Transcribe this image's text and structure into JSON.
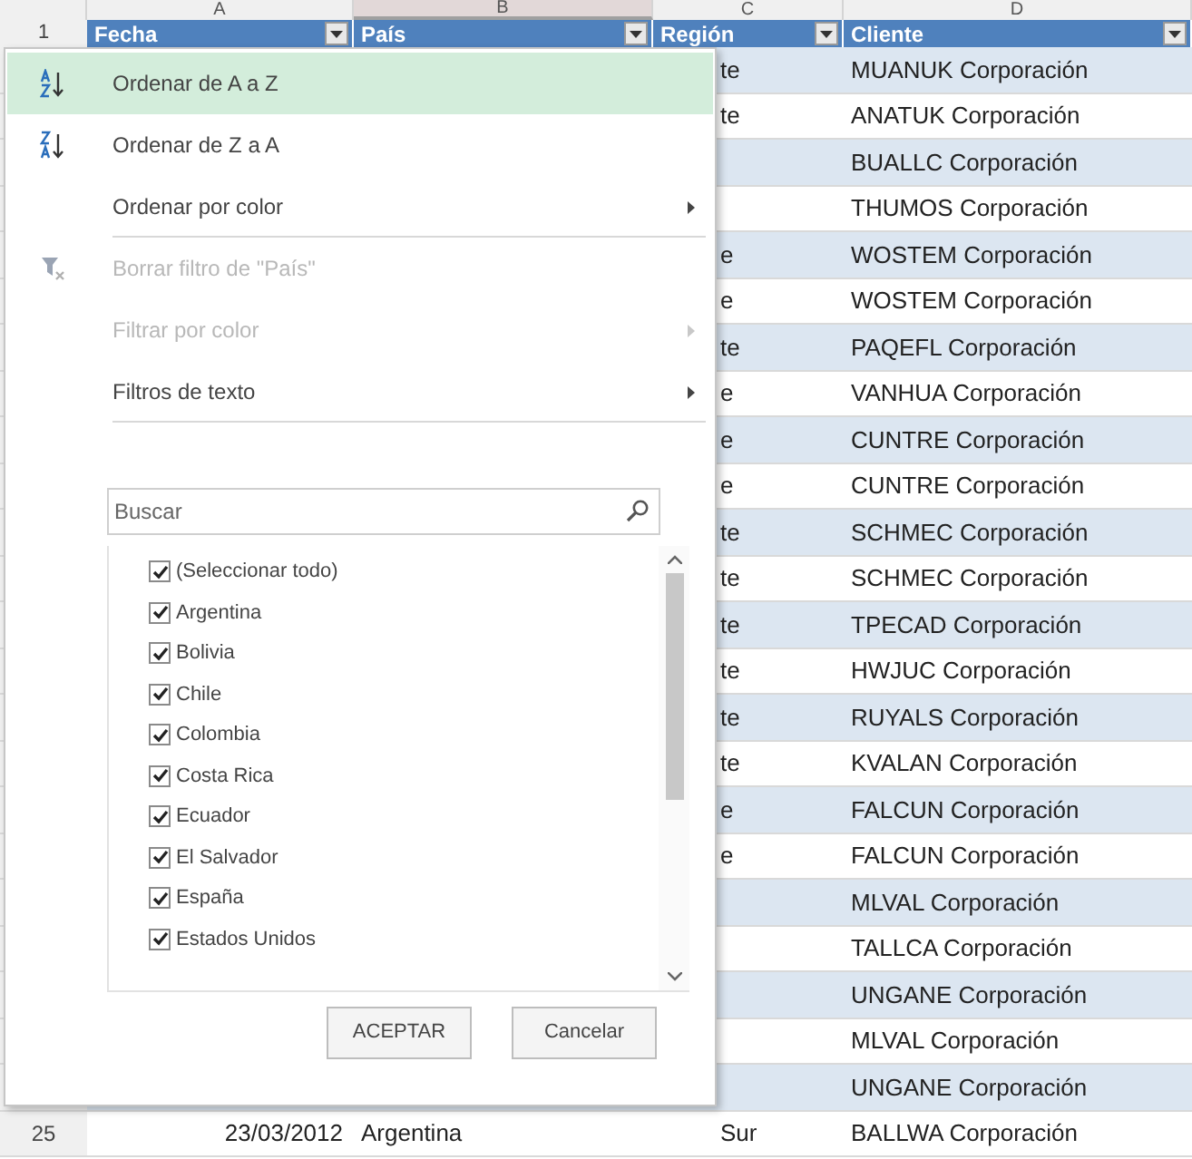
{
  "column_letters": [
    {
      "label": "A",
      "selected": false
    },
    {
      "label": "B",
      "selected": true
    },
    {
      "label": "C",
      "selected": false
    },
    {
      "label": "D",
      "selected": false
    }
  ],
  "header_row": {
    "number": "1",
    "cells": [
      "Fecha",
      "País",
      "Región",
      "Cliente"
    ]
  },
  "rows": [
    {
      "region": "te",
      "client": "MUANUK Corporación"
    },
    {
      "region": "te",
      "client": "ANATUK Corporación"
    },
    {
      "client": "BUALLC Corporación"
    },
    {
      "client": "THUMOS Corporación"
    },
    {
      "region": "e",
      "client": "WOSTEM Corporación"
    },
    {
      "region": "e",
      "client": "WOSTEM Corporación"
    },
    {
      "region": "te",
      "client": "PAQEFL Corporación"
    },
    {
      "region": "e",
      "client": "VANHUA Corporación"
    },
    {
      "region": "e",
      "client": "CUNTRE Corporación"
    },
    {
      "region": "e",
      "client": "CUNTRE Corporación"
    },
    {
      "region": "te",
      "client": "SCHMEC Corporación"
    },
    {
      "region": "te",
      "client": "SCHMEC Corporación"
    },
    {
      "region": "te",
      "client": "TPECAD Corporación"
    },
    {
      "region": "te",
      "client": "HWJUC Corporación"
    },
    {
      "region": "te",
      "client": "RUYALS Corporación"
    },
    {
      "region": "te",
      "client": "KVALAN Corporación"
    },
    {
      "region": "e",
      "client": "FALCUN Corporación"
    },
    {
      "region": "e",
      "client": "FALCUN Corporación"
    },
    {
      "client": "MLVAL Corporación"
    },
    {
      "client": "TALLCA Corporación"
    },
    {
      "client": "UNGANE Corporación"
    },
    {
      "client": "MLVAL Corporación"
    },
    {
      "client": "UNGANE Corporación"
    },
    {
      "number": "25",
      "date": "23/03/2012",
      "country": "Argentina",
      "region": "Sur",
      "client": "BALLWA Corporación"
    }
  ],
  "filter_menu": {
    "items": [
      {
        "label": "Ordenar de A a Z",
        "kind": "ascending",
        "highlighted": true,
        "disabled": false,
        "submenu": false,
        "separator_after": false
      },
      {
        "label": "Ordenar de Z a A",
        "kind": "descending",
        "highlighted": false,
        "disabled": false,
        "submenu": false,
        "separator_after": false
      },
      {
        "label": "Ordenar por color",
        "kind": "plain",
        "highlighted": false,
        "disabled": false,
        "submenu": true,
        "separator_after": true
      },
      {
        "label": "Borrar filtro de \"País\"",
        "kind": "clear",
        "highlighted": false,
        "disabled": true,
        "submenu": false,
        "separator_after": false
      },
      {
        "label": "Filtrar por color",
        "kind": "plain",
        "highlighted": false,
        "disabled": true,
        "submenu": true,
        "separator_after": false
      },
      {
        "label": "Filtros de texto",
        "kind": "plain",
        "highlighted": false,
        "disabled": false,
        "submenu": true,
        "separator_after": true
      }
    ],
    "search": {
      "placeholder": "Buscar"
    },
    "values": [
      {
        "label": "(Seleccionar todo)",
        "checked": true
      },
      {
        "label": "Argentina",
        "checked": true
      },
      {
        "label": "Bolivia",
        "checked": true
      },
      {
        "label": "Chile",
        "checked": true
      },
      {
        "label": "Colombia",
        "checked": true
      },
      {
        "label": "Costa Rica",
        "checked": true
      },
      {
        "label": "Ecuador",
        "checked": true
      },
      {
        "label": "El Salvador",
        "checked": true
      },
      {
        "label": "España",
        "checked": true
      },
      {
        "label": "Estados Unidos",
        "checked": true
      }
    ],
    "buttons": [
      "ACEPTAR",
      "Cancelar"
    ]
  }
}
